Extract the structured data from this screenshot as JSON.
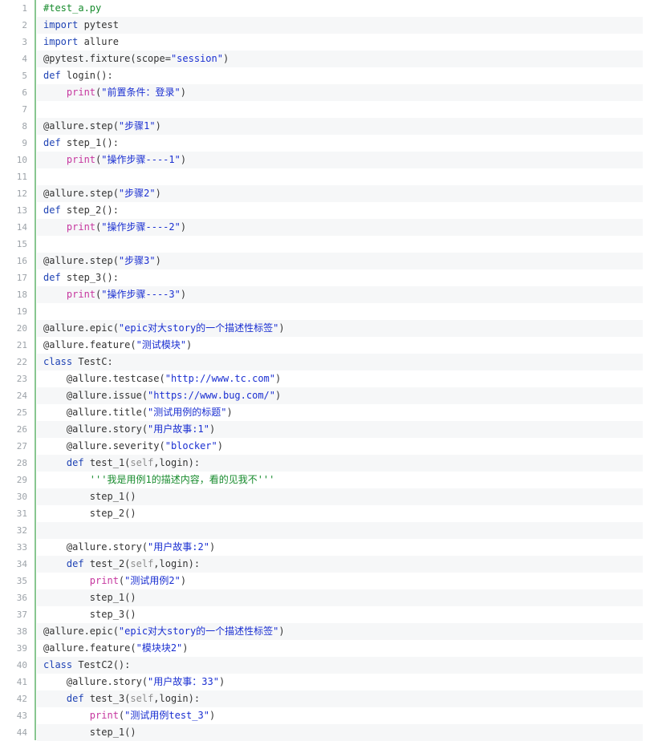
{
  "file": {
    "language": "python",
    "colors": {
      "keyword": "#1f43b5",
      "string": "#1a2fd1",
      "builtin": "#c6379f",
      "comment": "#178b2d",
      "self": "#8d8d8d",
      "plain": "#333333",
      "line_number": "#9da3a9",
      "gutter_rule": "#88c690",
      "stripe": "#f6f7f8"
    },
    "lines": [
      {
        "n": "1",
        "tokens": [
          {
            "t": "com",
            "v": "#test_a.py"
          }
        ]
      },
      {
        "n": "2",
        "tokens": [
          {
            "t": "kw",
            "v": "import"
          },
          {
            "t": "plain",
            "v": " pytest"
          }
        ]
      },
      {
        "n": "3",
        "tokens": [
          {
            "t": "kw",
            "v": "import"
          },
          {
            "t": "plain",
            "v": " allure"
          }
        ]
      },
      {
        "n": "4",
        "tokens": [
          {
            "t": "plain",
            "v": "@pytest.fixture(scope="
          },
          {
            "t": "str",
            "v": "\"session\""
          },
          {
            "t": "plain",
            "v": ")"
          }
        ]
      },
      {
        "n": "5",
        "tokens": [
          {
            "t": "kw",
            "v": "def"
          },
          {
            "t": "plain",
            "v": " login():"
          }
        ]
      },
      {
        "n": "6",
        "tokens": [
          {
            "t": "plain",
            "v": "    "
          },
          {
            "t": "fn",
            "v": "print"
          },
          {
            "t": "plain",
            "v": "("
          },
          {
            "t": "str",
            "v": "\"前置条件：登录\""
          },
          {
            "t": "plain",
            "v": ")"
          }
        ]
      },
      {
        "n": "7",
        "tokens": []
      },
      {
        "n": "8",
        "tokens": [
          {
            "t": "plain",
            "v": "@allure.step("
          },
          {
            "t": "str",
            "v": "\"步骤1\""
          },
          {
            "t": "plain",
            "v": ")"
          }
        ]
      },
      {
        "n": "9",
        "tokens": [
          {
            "t": "kw",
            "v": "def"
          },
          {
            "t": "plain",
            "v": " step_1():"
          }
        ]
      },
      {
        "n": "10",
        "tokens": [
          {
            "t": "plain",
            "v": "    "
          },
          {
            "t": "fn",
            "v": "print"
          },
          {
            "t": "plain",
            "v": "("
          },
          {
            "t": "str",
            "v": "\"操作步骤----1\""
          },
          {
            "t": "plain",
            "v": ")"
          }
        ]
      },
      {
        "n": "11",
        "tokens": []
      },
      {
        "n": "12",
        "tokens": [
          {
            "t": "plain",
            "v": "@allure.step("
          },
          {
            "t": "str",
            "v": "\"步骤2\""
          },
          {
            "t": "plain",
            "v": ")"
          }
        ]
      },
      {
        "n": "13",
        "tokens": [
          {
            "t": "kw",
            "v": "def"
          },
          {
            "t": "plain",
            "v": " step_2():"
          }
        ]
      },
      {
        "n": "14",
        "tokens": [
          {
            "t": "plain",
            "v": "    "
          },
          {
            "t": "fn",
            "v": "print"
          },
          {
            "t": "plain",
            "v": "("
          },
          {
            "t": "str",
            "v": "\"操作步骤----2\""
          },
          {
            "t": "plain",
            "v": ")"
          }
        ]
      },
      {
        "n": "15",
        "tokens": []
      },
      {
        "n": "16",
        "tokens": [
          {
            "t": "plain",
            "v": "@allure.step("
          },
          {
            "t": "str",
            "v": "\"步骤3\""
          },
          {
            "t": "plain",
            "v": ")"
          }
        ]
      },
      {
        "n": "17",
        "tokens": [
          {
            "t": "kw",
            "v": "def"
          },
          {
            "t": "plain",
            "v": " step_3():"
          }
        ]
      },
      {
        "n": "18",
        "tokens": [
          {
            "t": "plain",
            "v": "    "
          },
          {
            "t": "fn",
            "v": "print"
          },
          {
            "t": "plain",
            "v": "("
          },
          {
            "t": "str",
            "v": "\"操作步骤----3\""
          },
          {
            "t": "plain",
            "v": ")"
          }
        ]
      },
      {
        "n": "19",
        "tokens": []
      },
      {
        "n": "20",
        "tokens": [
          {
            "t": "plain",
            "v": "@allure.epic("
          },
          {
            "t": "str",
            "v": "\"epic对大story的一个描述性标签\""
          },
          {
            "t": "plain",
            "v": ")"
          }
        ]
      },
      {
        "n": "21",
        "tokens": [
          {
            "t": "plain",
            "v": "@allure.feature("
          },
          {
            "t": "str",
            "v": "\"测试模块\""
          },
          {
            "t": "plain",
            "v": ")"
          }
        ]
      },
      {
        "n": "22",
        "tokens": [
          {
            "t": "kw",
            "v": "class"
          },
          {
            "t": "plain",
            "v": " TestC:"
          }
        ]
      },
      {
        "n": "23",
        "tokens": [
          {
            "t": "plain",
            "v": "    @allure.testcase("
          },
          {
            "t": "str",
            "v": "\"http://www.tc.com\""
          },
          {
            "t": "plain",
            "v": ")"
          }
        ]
      },
      {
        "n": "24",
        "tokens": [
          {
            "t": "plain",
            "v": "    @allure.issue("
          },
          {
            "t": "str",
            "v": "\"https://www.bug.com/\""
          },
          {
            "t": "plain",
            "v": ")"
          }
        ]
      },
      {
        "n": "25",
        "tokens": [
          {
            "t": "plain",
            "v": "    @allure.title("
          },
          {
            "t": "str",
            "v": "\"测试用例的标题\""
          },
          {
            "t": "plain",
            "v": ")"
          }
        ]
      },
      {
        "n": "26",
        "tokens": [
          {
            "t": "plain",
            "v": "    @allure.story("
          },
          {
            "t": "str",
            "v": "\"用户故事:1\""
          },
          {
            "t": "plain",
            "v": ")"
          }
        ]
      },
      {
        "n": "27",
        "tokens": [
          {
            "t": "plain",
            "v": "    @allure.severity("
          },
          {
            "t": "str",
            "v": "\"blocker\""
          },
          {
            "t": "plain",
            "v": ")"
          }
        ]
      },
      {
        "n": "28",
        "tokens": [
          {
            "t": "plain",
            "v": "    "
          },
          {
            "t": "kw",
            "v": "def"
          },
          {
            "t": "plain",
            "v": " test_1("
          },
          {
            "t": "self",
            "v": "self"
          },
          {
            "t": "plain",
            "v": ",login):"
          }
        ]
      },
      {
        "n": "29",
        "tokens": [
          {
            "t": "plain",
            "v": "        "
          },
          {
            "t": "com",
            "v": "'''我是用例1的描述内容，看的见我不'''"
          }
        ]
      },
      {
        "n": "30",
        "tokens": [
          {
            "t": "plain",
            "v": "        step_1()"
          }
        ]
      },
      {
        "n": "31",
        "tokens": [
          {
            "t": "plain",
            "v": "        step_2()"
          }
        ]
      },
      {
        "n": "32",
        "tokens": []
      },
      {
        "n": "33",
        "tokens": [
          {
            "t": "plain",
            "v": "    @allure.story("
          },
          {
            "t": "str",
            "v": "\"用户故事:2\""
          },
          {
            "t": "plain",
            "v": ")"
          }
        ]
      },
      {
        "n": "34",
        "tokens": [
          {
            "t": "plain",
            "v": "    "
          },
          {
            "t": "kw",
            "v": "def"
          },
          {
            "t": "plain",
            "v": " test_2("
          },
          {
            "t": "self",
            "v": "self"
          },
          {
            "t": "plain",
            "v": ",login):"
          }
        ]
      },
      {
        "n": "35",
        "tokens": [
          {
            "t": "plain",
            "v": "        "
          },
          {
            "t": "fn",
            "v": "print"
          },
          {
            "t": "plain",
            "v": "("
          },
          {
            "t": "str",
            "v": "\"测试用例2\""
          },
          {
            "t": "plain",
            "v": ")"
          }
        ]
      },
      {
        "n": "36",
        "tokens": [
          {
            "t": "plain",
            "v": "        step_1()"
          }
        ]
      },
      {
        "n": "37",
        "tokens": [
          {
            "t": "plain",
            "v": "        step_3()"
          }
        ]
      },
      {
        "n": "38",
        "tokens": [
          {
            "t": "plain",
            "v": "@allure.epic("
          },
          {
            "t": "str",
            "v": "\"epic对大story的一个描述性标签\""
          },
          {
            "t": "plain",
            "v": ")"
          }
        ]
      },
      {
        "n": "39",
        "tokens": [
          {
            "t": "plain",
            "v": "@allure.feature("
          },
          {
            "t": "str",
            "v": "\"模块块2\""
          },
          {
            "t": "plain",
            "v": ")"
          }
        ]
      },
      {
        "n": "40",
        "tokens": [
          {
            "t": "kw",
            "v": "class"
          },
          {
            "t": "plain",
            "v": " TestC2():"
          }
        ]
      },
      {
        "n": "41",
        "tokens": [
          {
            "t": "plain",
            "v": "    @allure.story("
          },
          {
            "t": "str",
            "v": "\"用户故事：33\""
          },
          {
            "t": "plain",
            "v": ")"
          }
        ]
      },
      {
        "n": "42",
        "tokens": [
          {
            "t": "plain",
            "v": "    "
          },
          {
            "t": "kw",
            "v": "def"
          },
          {
            "t": "plain",
            "v": " test_3("
          },
          {
            "t": "self",
            "v": "self"
          },
          {
            "t": "plain",
            "v": ",login):"
          }
        ]
      },
      {
        "n": "43",
        "tokens": [
          {
            "t": "plain",
            "v": "        "
          },
          {
            "t": "fn",
            "v": "print"
          },
          {
            "t": "plain",
            "v": "("
          },
          {
            "t": "str",
            "v": "\"测试用例test_3\""
          },
          {
            "t": "plain",
            "v": ")"
          }
        ]
      },
      {
        "n": "44",
        "tokens": [
          {
            "t": "plain",
            "v": "        step_1()"
          }
        ]
      }
    ]
  }
}
